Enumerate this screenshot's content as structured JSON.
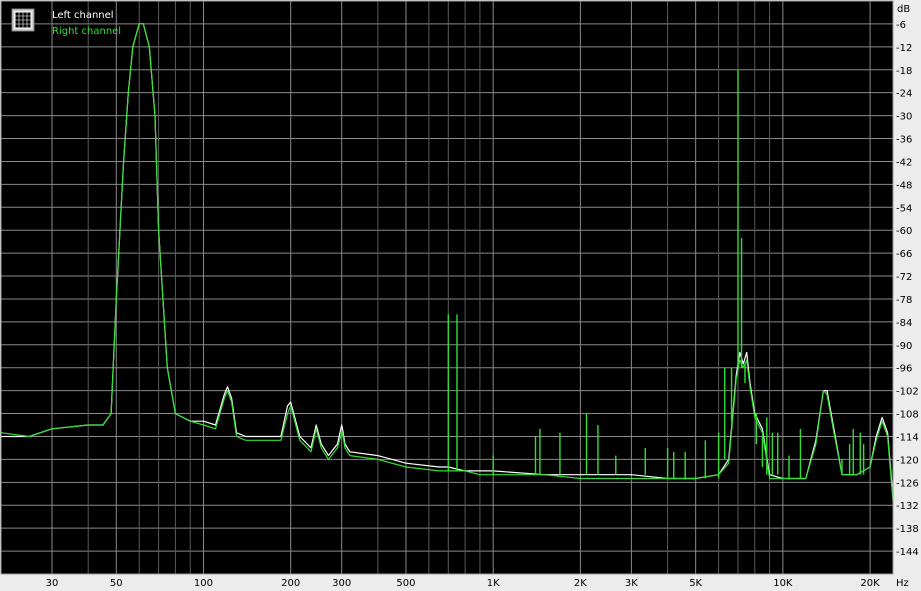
{
  "chart_data": {
    "type": "line",
    "xscale": "log",
    "yunit": "dB",
    "xunit": "Hz",
    "xlim": [
      20,
      24000
    ],
    "ylim": [
      -150,
      0
    ],
    "grid": true,
    "legend_position": "top-left",
    "y_ticks": [
      "-6",
      "-12",
      "-18",
      "-24",
      "-30",
      "-36",
      "-42",
      "-48",
      "-54",
      "-60",
      "-66",
      "-72",
      "-78",
      "-84",
      "-90",
      "-96",
      "-102",
      "-108",
      "-114",
      "-120",
      "-126",
      "-132",
      "-138",
      "-144"
    ],
    "x_ticks": [
      {
        "value": 30,
        "label": "30"
      },
      {
        "value": 50,
        "label": "50"
      },
      {
        "value": 100,
        "label": "100"
      },
      {
        "value": 200,
        "label": "200"
      },
      {
        "value": 300,
        "label": "300"
      },
      {
        "value": 500,
        "label": "500"
      },
      {
        "value": 1000,
        "label": "1K"
      },
      {
        "value": 2000,
        "label": "2K"
      },
      {
        "value": 3000,
        "label": "3K"
      },
      {
        "value": 5000,
        "label": "5K"
      },
      {
        "value": 10000,
        "label": "10K"
      },
      {
        "value": 20000,
        "label": "20K"
      }
    ],
    "series": [
      {
        "name": "Left channel",
        "color": "#ffffff",
        "x": [
          20,
          25,
          30,
          40,
          45,
          48,
          50,
          53,
          55,
          57,
          60,
          62,
          65,
          68,
          70,
          75,
          80,
          90,
          100,
          110,
          118,
          121,
          125,
          130,
          140,
          150,
          170,
          185,
          195,
          200,
          215,
          235,
          245,
          255,
          270,
          290,
          300,
          302,
          308,
          320,
          400,
          500,
          650,
          700,
          800,
          900,
          1000,
          1500,
          2000,
          3000,
          4000,
          5000,
          6000,
          6500,
          6900,
          7100,
          7300,
          7500,
          7700,
          8000,
          8500,
          9000,
          10000,
          12000,
          13000,
          13800,
          14200,
          15000,
          16000,
          18000,
          20000,
          21000,
          22000,
          23000,
          24000
        ],
        "values": [
          -114,
          -114,
          -112,
          -111,
          -111,
          -108,
          -78,
          -42,
          -24,
          -12,
          -6,
          -6,
          -12,
          -30,
          -60,
          -96,
          -108,
          -110,
          -110,
          -111,
          -103,
          -101,
          -104,
          -113,
          -114,
          -114,
          -114,
          -114,
          -106,
          -105,
          -114,
          -117,
          -111,
          -116,
          -119,
          -116,
          -111,
          -112,
          -116,
          -118,
          -119,
          -121,
          -122,
          -122,
          -123,
          -123,
          -123,
          -124,
          -124,
          -124,
          -125,
          -125,
          -124,
          -120,
          -98,
          -92,
          -95,
          -92,
          -100,
          -108,
          -112,
          -124,
          -125,
          -125,
          -115,
          -102,
          -102,
          -112,
          -124,
          -124,
          -122,
          -114,
          -109,
          -113,
          -130
        ]
      },
      {
        "name": "Right channel",
        "color": "#33dd33",
        "x": [
          20,
          25,
          30,
          40,
          45,
          48,
          50,
          53,
          55,
          57,
          60,
          62,
          65,
          68,
          70,
          75,
          80,
          90,
          100,
          110,
          118,
          121,
          125,
          130,
          140,
          150,
          170,
          185,
          195,
          200,
          215,
          235,
          245,
          255,
          270,
          290,
          300,
          302,
          308,
          320,
          400,
          500,
          650,
          700,
          800,
          900,
          1000,
          1500,
          2000,
          3000,
          4000,
          5000,
          6000,
          6500,
          6900,
          7100,
          7300,
          7500,
          7700,
          8000,
          8500,
          9000,
          10000,
          12000,
          13000,
          13800,
          14200,
          15000,
          16000,
          18000,
          20000,
          21000,
          22000,
          23000,
          24000
        ],
        "values": [
          -113,
          -114,
          -112,
          -111,
          -111,
          -108,
          -78,
          -42,
          -24,
          -12,
          -6,
          -6,
          -12,
          -30,
          -60,
          -96,
          -108,
          -110,
          -111,
          -112,
          -104,
          -102,
          -105,
          -114,
          -115,
          -115,
          -115,
          -115,
          -108,
          -106,
          -115,
          -118,
          -112,
          -117,
          -120,
          -117,
          -113,
          -113,
          -117,
          -119,
          -120,
          -122,
          -123,
          -123,
          -123,
          -124,
          -124,
          -124,
          -125,
          -125,
          -125,
          -125,
          -124,
          -121,
          -99,
          -94,
          -96,
          -94,
          -101,
          -109,
          -113,
          -125,
          -125,
          -125,
          -116,
          -102,
          -103,
          -113,
          -124,
          -124,
          -122,
          -115,
          -110,
          -114,
          -131
        ]
      }
    ],
    "spikes": [
      {
        "x": 700,
        "value": -82,
        "base": -123
      },
      {
        "x": 750,
        "value": -82,
        "base": -123
      },
      {
        "x": 1000,
        "value": -119,
        "base": -124
      },
      {
        "x": 1400,
        "value": -114,
        "base": -124
      },
      {
        "x": 1450,
        "value": -112,
        "base": -124
      },
      {
        "x": 1700,
        "value": -113,
        "base": -124
      },
      {
        "x": 2100,
        "value": -108,
        "base": -124
      },
      {
        "x": 2300,
        "value": -111,
        "base": -124
      },
      {
        "x": 2650,
        "value": -119,
        "base": -124
      },
      {
        "x": 3350,
        "value": -117,
        "base": -124
      },
      {
        "x": 4000,
        "value": -117,
        "base": -125
      },
      {
        "x": 4200,
        "value": -118,
        "base": -125
      },
      {
        "x": 4600,
        "value": -118,
        "base": -125
      },
      {
        "x": 5400,
        "value": -115,
        "base": -125
      },
      {
        "x": 6000,
        "value": -113,
        "base": -125
      },
      {
        "x": 6300,
        "value": -96,
        "base": -120
      },
      {
        "x": 6650,
        "value": -96,
        "base": -110
      },
      {
        "x": 7000,
        "value": -18,
        "base": -96
      },
      {
        "x": 7200,
        "value": -62,
        "base": -96
      },
      {
        "x": 7400,
        "value": -95,
        "base": -100
      },
      {
        "x": 8100,
        "value": -108,
        "base": -116
      },
      {
        "x": 8500,
        "value": -114,
        "base": -122
      },
      {
        "x": 8800,
        "value": -109,
        "base": -124
      },
      {
        "x": 9200,
        "value": -113,
        "base": -124
      },
      {
        "x": 9600,
        "value": -113,
        "base": -124
      },
      {
        "x": 10500,
        "value": -119,
        "base": -125
      },
      {
        "x": 11500,
        "value": -112,
        "base": -125
      },
      {
        "x": 16000,
        "value": -120,
        "base": -124
      },
      {
        "x": 17000,
        "value": -116,
        "base": -124
      },
      {
        "x": 17500,
        "value": -112,
        "base": -124
      },
      {
        "x": 18500,
        "value": -113,
        "base": -124
      },
      {
        "x": 19000,
        "value": -116,
        "base": -124
      }
    ]
  },
  "legend": {
    "items": [
      {
        "label": "Left channel",
        "color": "#ffffff"
      },
      {
        "label": "Right channel",
        "color": "#33dd33"
      }
    ],
    "icon": "chart-icon"
  },
  "axis": {
    "y_unit_label": "dB",
    "x_unit_label": "Hz"
  }
}
